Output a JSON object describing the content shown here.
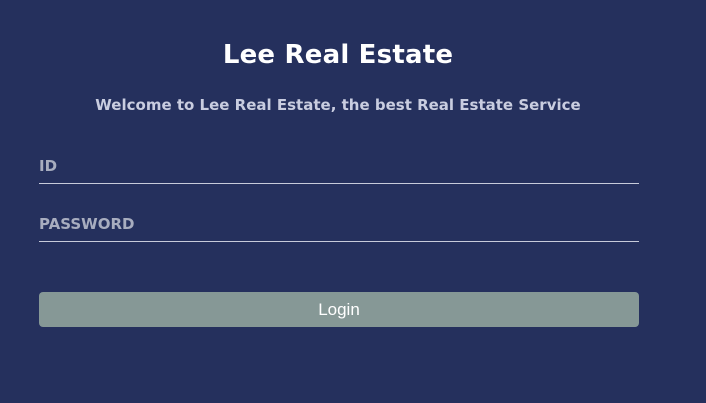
{
  "app": {
    "title": "Lee Real Estate",
    "subtitle": "Welcome to Lee Real Estate, the best Real Estate Service"
  },
  "login_form": {
    "id_field": {
      "placeholder": "ID",
      "value": ""
    },
    "password_field": {
      "placeholder": "PASSWORD",
      "value": ""
    },
    "login_button_label": "Login"
  },
  "colors": {
    "background": "#25305d",
    "button": "#869896",
    "title_text": "#ffffff",
    "subtitle_text": "#c9cde0",
    "placeholder_text": "#a8adbf",
    "underline": "#c7cbda"
  }
}
